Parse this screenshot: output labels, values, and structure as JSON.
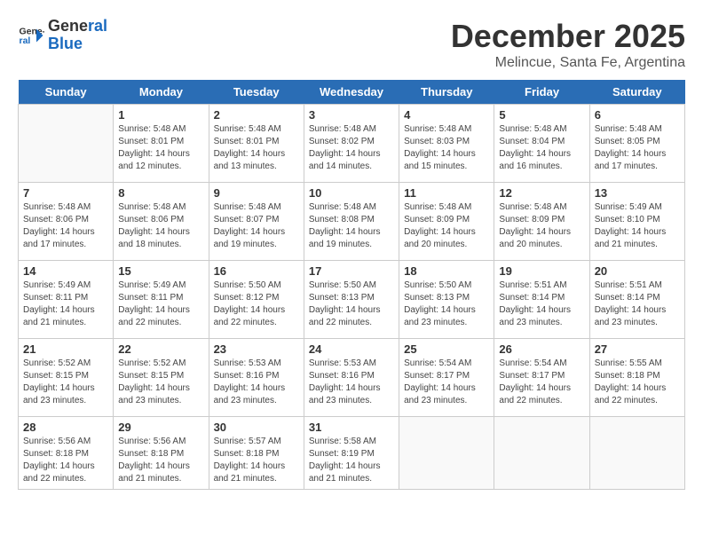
{
  "logo": {
    "line1": "General",
    "line2": "Blue"
  },
  "title": "December 2025",
  "subtitle": "Melincue, Santa Fe, Argentina",
  "headers": [
    "Sunday",
    "Monday",
    "Tuesday",
    "Wednesday",
    "Thursday",
    "Friday",
    "Saturday"
  ],
  "weeks": [
    [
      {
        "day": "",
        "info": ""
      },
      {
        "day": "1",
        "info": "Sunrise: 5:48 AM\nSunset: 8:01 PM\nDaylight: 14 hours\nand 12 minutes."
      },
      {
        "day": "2",
        "info": "Sunrise: 5:48 AM\nSunset: 8:01 PM\nDaylight: 14 hours\nand 13 minutes."
      },
      {
        "day": "3",
        "info": "Sunrise: 5:48 AM\nSunset: 8:02 PM\nDaylight: 14 hours\nand 14 minutes."
      },
      {
        "day": "4",
        "info": "Sunrise: 5:48 AM\nSunset: 8:03 PM\nDaylight: 14 hours\nand 15 minutes."
      },
      {
        "day": "5",
        "info": "Sunrise: 5:48 AM\nSunset: 8:04 PM\nDaylight: 14 hours\nand 16 minutes."
      },
      {
        "day": "6",
        "info": "Sunrise: 5:48 AM\nSunset: 8:05 PM\nDaylight: 14 hours\nand 17 minutes."
      }
    ],
    [
      {
        "day": "7",
        "info": "Sunrise: 5:48 AM\nSunset: 8:06 PM\nDaylight: 14 hours\nand 17 minutes."
      },
      {
        "day": "8",
        "info": "Sunrise: 5:48 AM\nSunset: 8:06 PM\nDaylight: 14 hours\nand 18 minutes."
      },
      {
        "day": "9",
        "info": "Sunrise: 5:48 AM\nSunset: 8:07 PM\nDaylight: 14 hours\nand 19 minutes."
      },
      {
        "day": "10",
        "info": "Sunrise: 5:48 AM\nSunset: 8:08 PM\nDaylight: 14 hours\nand 19 minutes."
      },
      {
        "day": "11",
        "info": "Sunrise: 5:48 AM\nSunset: 8:09 PM\nDaylight: 14 hours\nand 20 minutes."
      },
      {
        "day": "12",
        "info": "Sunrise: 5:48 AM\nSunset: 8:09 PM\nDaylight: 14 hours\nand 20 minutes."
      },
      {
        "day": "13",
        "info": "Sunrise: 5:49 AM\nSunset: 8:10 PM\nDaylight: 14 hours\nand 21 minutes."
      }
    ],
    [
      {
        "day": "14",
        "info": "Sunrise: 5:49 AM\nSunset: 8:11 PM\nDaylight: 14 hours\nand 21 minutes."
      },
      {
        "day": "15",
        "info": "Sunrise: 5:49 AM\nSunset: 8:11 PM\nDaylight: 14 hours\nand 22 minutes."
      },
      {
        "day": "16",
        "info": "Sunrise: 5:50 AM\nSunset: 8:12 PM\nDaylight: 14 hours\nand 22 minutes."
      },
      {
        "day": "17",
        "info": "Sunrise: 5:50 AM\nSunset: 8:13 PM\nDaylight: 14 hours\nand 22 minutes."
      },
      {
        "day": "18",
        "info": "Sunrise: 5:50 AM\nSunset: 8:13 PM\nDaylight: 14 hours\nand 23 minutes."
      },
      {
        "day": "19",
        "info": "Sunrise: 5:51 AM\nSunset: 8:14 PM\nDaylight: 14 hours\nand 23 minutes."
      },
      {
        "day": "20",
        "info": "Sunrise: 5:51 AM\nSunset: 8:14 PM\nDaylight: 14 hours\nand 23 minutes."
      }
    ],
    [
      {
        "day": "21",
        "info": "Sunrise: 5:52 AM\nSunset: 8:15 PM\nDaylight: 14 hours\nand 23 minutes."
      },
      {
        "day": "22",
        "info": "Sunrise: 5:52 AM\nSunset: 8:15 PM\nDaylight: 14 hours\nand 23 minutes."
      },
      {
        "day": "23",
        "info": "Sunrise: 5:53 AM\nSunset: 8:16 PM\nDaylight: 14 hours\nand 23 minutes."
      },
      {
        "day": "24",
        "info": "Sunrise: 5:53 AM\nSunset: 8:16 PM\nDaylight: 14 hours\nand 23 minutes."
      },
      {
        "day": "25",
        "info": "Sunrise: 5:54 AM\nSunset: 8:17 PM\nDaylight: 14 hours\nand 23 minutes."
      },
      {
        "day": "26",
        "info": "Sunrise: 5:54 AM\nSunset: 8:17 PM\nDaylight: 14 hours\nand 22 minutes."
      },
      {
        "day": "27",
        "info": "Sunrise: 5:55 AM\nSunset: 8:18 PM\nDaylight: 14 hours\nand 22 minutes."
      }
    ],
    [
      {
        "day": "28",
        "info": "Sunrise: 5:56 AM\nSunset: 8:18 PM\nDaylight: 14 hours\nand 22 minutes."
      },
      {
        "day": "29",
        "info": "Sunrise: 5:56 AM\nSunset: 8:18 PM\nDaylight: 14 hours\nand 21 minutes."
      },
      {
        "day": "30",
        "info": "Sunrise: 5:57 AM\nSunset: 8:18 PM\nDaylight: 14 hours\nand 21 minutes."
      },
      {
        "day": "31",
        "info": "Sunrise: 5:58 AM\nSunset: 8:19 PM\nDaylight: 14 hours\nand 21 minutes."
      },
      {
        "day": "",
        "info": ""
      },
      {
        "day": "",
        "info": ""
      },
      {
        "day": "",
        "info": ""
      }
    ]
  ]
}
